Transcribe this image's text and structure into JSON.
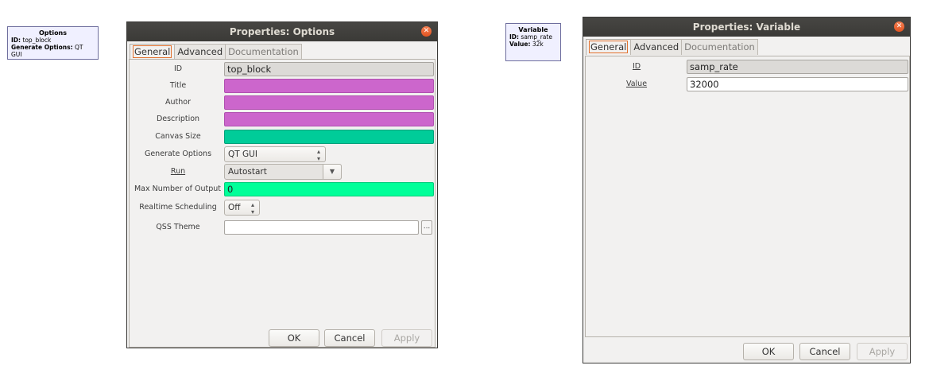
{
  "options_block": {
    "title": "Options",
    "id_label": "ID:",
    "id_value": "top_block",
    "gen_label": "Generate Options:",
    "gen_value": "QT GUI"
  },
  "variable_block": {
    "title": "Variable",
    "id_label": "ID:",
    "id_value": "samp_rate",
    "value_label": "Value:",
    "value_value": "32k"
  },
  "options_dialog": {
    "title": "Properties: Options",
    "tabs": [
      "General",
      "Advanced",
      "Documentation"
    ],
    "labels": {
      "id": "ID",
      "title": "Title",
      "author": "Author",
      "description": "Description",
      "canvas_size": "Canvas Size",
      "generate_options": "Generate Options",
      "run": "Run",
      "max_output": "Max Number of Output",
      "realtime": "Realtime Scheduling",
      "qss": "QSS Theme"
    },
    "values": {
      "id": "top_block",
      "title": "",
      "author": "",
      "description": "",
      "canvas_size": "",
      "generate_options": "QT GUI",
      "run": "Autostart",
      "max_output": "0",
      "realtime": "Off",
      "qss": ""
    },
    "dots_label": "...",
    "buttons": {
      "ok": "OK",
      "cancel": "Cancel",
      "apply": "Apply"
    }
  },
  "variable_dialog": {
    "title": "Properties: Variable",
    "tabs": [
      "General",
      "Advanced",
      "Documentation"
    ],
    "labels": {
      "id": "ID",
      "value": "Value"
    },
    "values": {
      "id": "samp_rate",
      "value": "32000"
    },
    "buttons": {
      "ok": "OK",
      "cancel": "Cancel",
      "apply": "Apply"
    }
  },
  "colors": {
    "invalid_field": "#cc66cc",
    "canvas_field": "#00cc99",
    "valid_field": "#00ff99",
    "titlebar": "#3c3b37",
    "close": "#e25421"
  },
  "icons": {
    "close": "close-icon",
    "spin": "spin-arrows-icon",
    "dropdown": "chevron-down-icon"
  }
}
